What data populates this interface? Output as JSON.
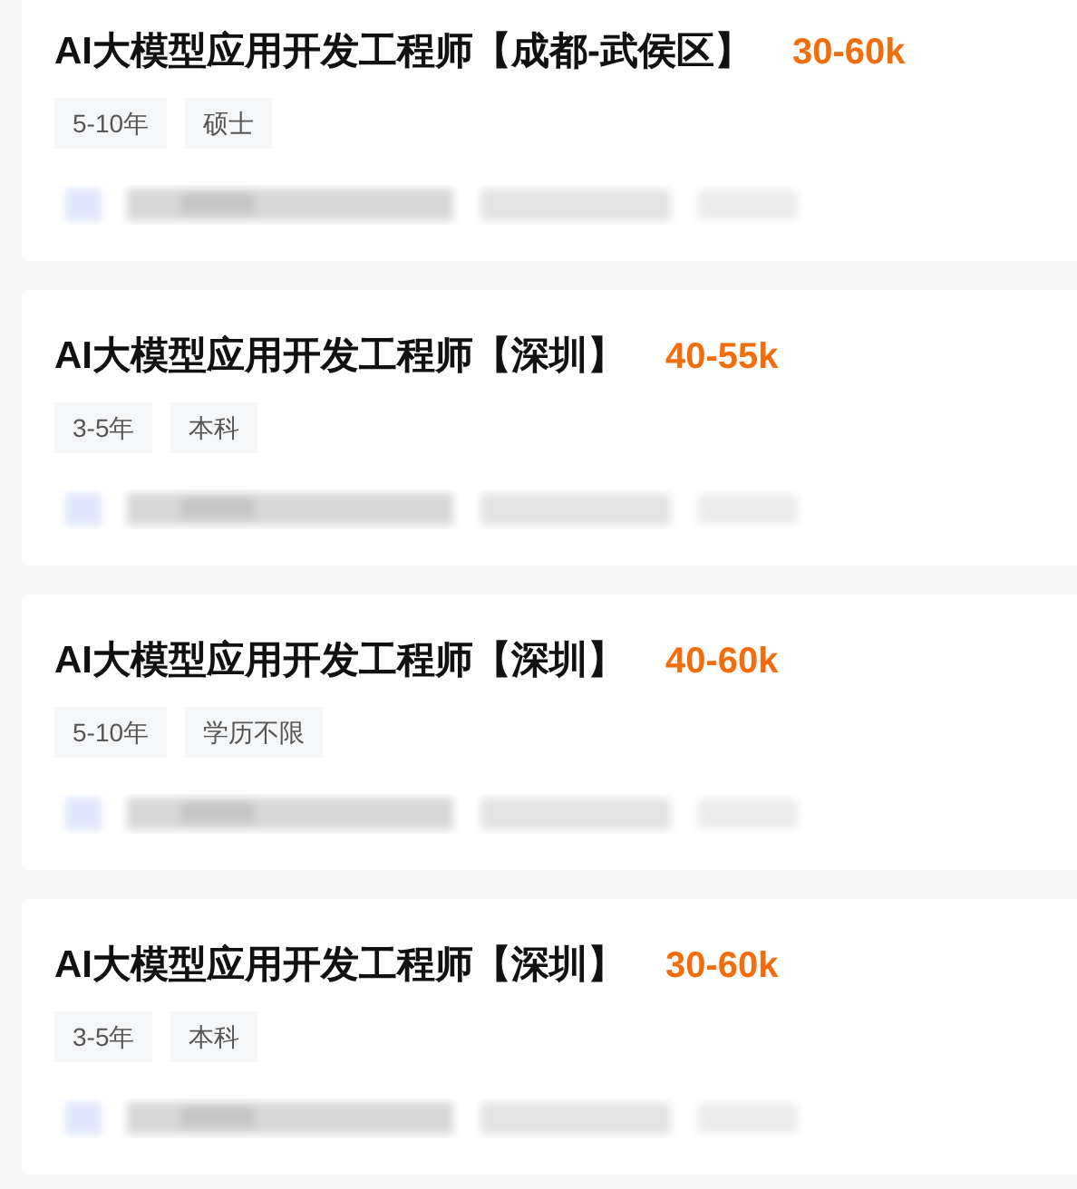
{
  "jobs": [
    {
      "title": "AI大模型应用开发工程师【成都-武侯区】",
      "salary": "30-60k",
      "tags": [
        "5-10年",
        "硕士"
      ]
    },
    {
      "title": "AI大模型应用开发工程师【深圳】",
      "salary": "40-55k",
      "tags": [
        "3-5年",
        "本科"
      ]
    },
    {
      "title": "AI大模型应用开发工程师【深圳】",
      "salary": "40-60k",
      "tags": [
        "5-10年",
        "学历不限"
      ]
    },
    {
      "title": "AI大模型应用开发工程师【深圳】",
      "salary": "30-60k",
      "tags": [
        "3-5年",
        "本科"
      ]
    }
  ]
}
